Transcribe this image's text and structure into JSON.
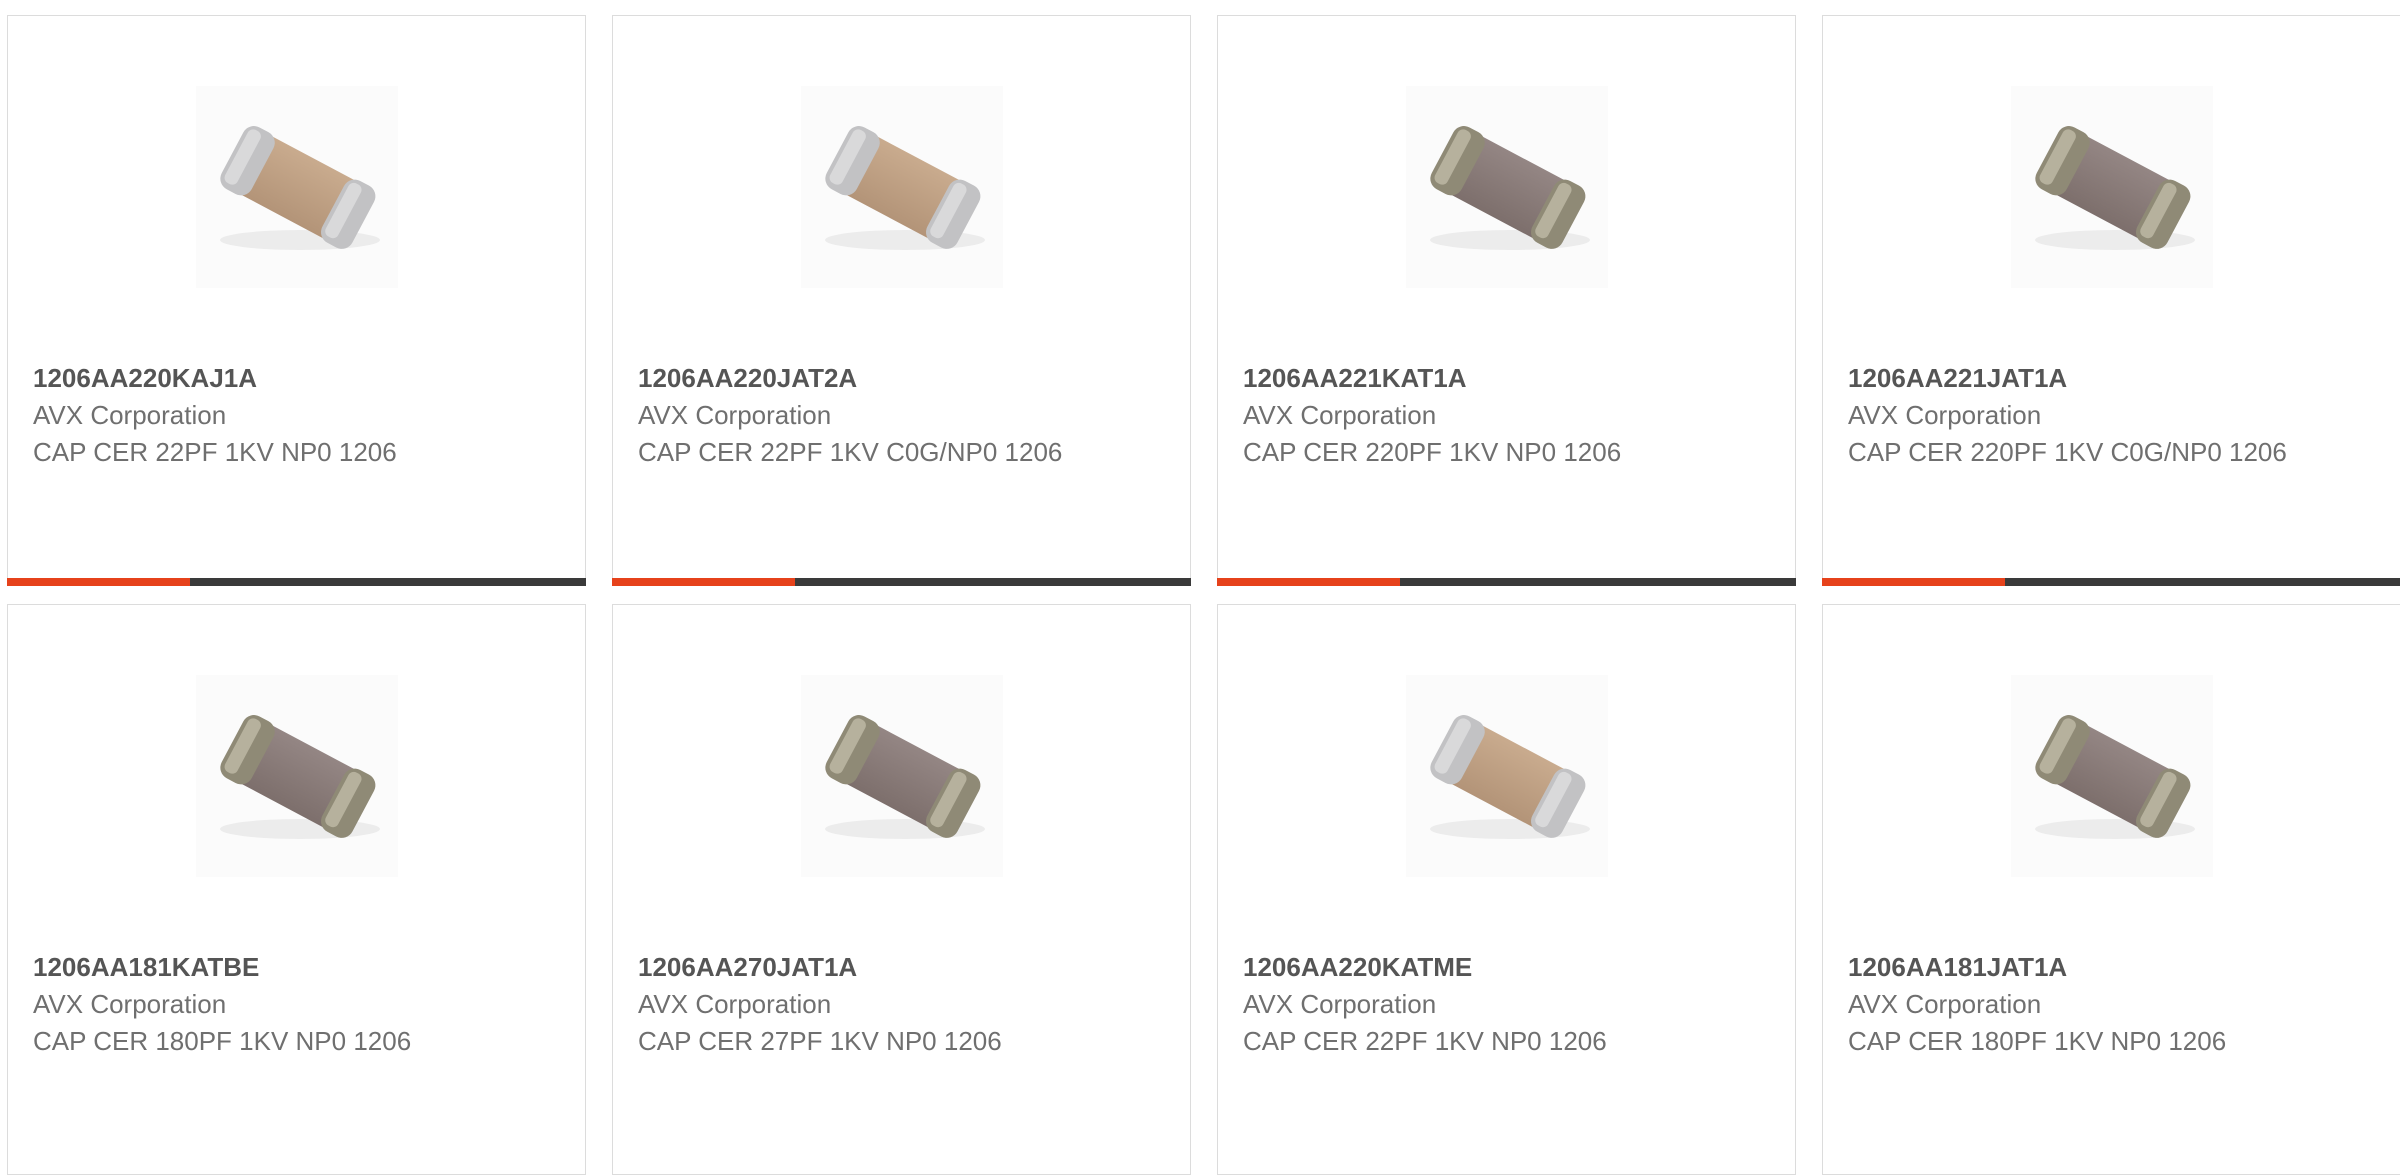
{
  "colors": {
    "accent": "#e6421b",
    "bar": "#3a3a3a",
    "border": "#dcdcdc"
  },
  "products": [
    {
      "part_number": "1206AA220KAJ1A",
      "manufacturer": "AVX Corporation",
      "description": "CAP CER 22PF 1KV NP0 1206",
      "image_icon": "ceramic-capacitor-tan-icon",
      "style": "tan",
      "show_bar": true
    },
    {
      "part_number": "1206AA220JAT2A",
      "manufacturer": "AVX Corporation",
      "description": "CAP CER 22PF 1KV C0G/NP0 1206",
      "image_icon": "ceramic-capacitor-tan-icon",
      "style": "tan",
      "show_bar": true
    },
    {
      "part_number": "1206AA221KAT1A",
      "manufacturer": "AVX Corporation",
      "description": "CAP CER 220PF 1KV NP0 1206",
      "image_icon": "ceramic-capacitor-dark-icon",
      "style": "dark",
      "show_bar": true
    },
    {
      "part_number": "1206AA221JAT1A",
      "manufacturer": "AVX Corporation",
      "description": "CAP CER 220PF 1KV C0G/NP0 1206",
      "image_icon": "ceramic-capacitor-dark-icon",
      "style": "dark",
      "show_bar": true
    },
    {
      "part_number": "1206AA181KATBE",
      "manufacturer": "AVX Corporation",
      "description": "CAP CER 180PF 1KV NP0 1206",
      "image_icon": "ceramic-capacitor-dark-icon",
      "style": "dark",
      "show_bar": false
    },
    {
      "part_number": "1206AA270JAT1A",
      "manufacturer": "AVX Corporation",
      "description": "CAP CER 27PF 1KV NP0 1206",
      "image_icon": "ceramic-capacitor-dark-icon",
      "style": "dark",
      "show_bar": false
    },
    {
      "part_number": "1206AA220KATME",
      "manufacturer": "AVX Corporation",
      "description": "CAP CER 22PF 1KV NP0 1206",
      "image_icon": "ceramic-capacitor-tan-icon",
      "style": "tan",
      "show_bar": false
    },
    {
      "part_number": "1206AA181JAT1A",
      "manufacturer": "AVX Corporation",
      "description": "CAP CER 180PF 1KV NP0 1206",
      "image_icon": "ceramic-capacitor-dark-icon",
      "style": "dark",
      "show_bar": false
    }
  ]
}
